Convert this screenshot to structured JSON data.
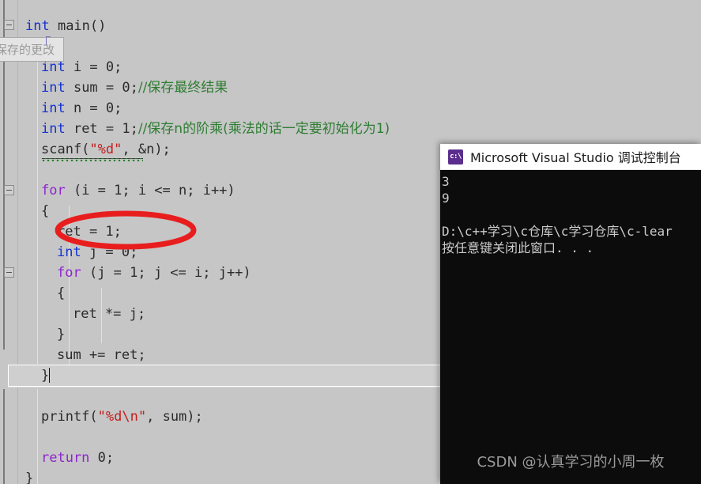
{
  "editor": {
    "background_color": "#c6c6c6",
    "tooltip": {
      "text": "保存的更改"
    },
    "annotation": {
      "shape": "red-ellipse",
      "color": "#e81e1e",
      "target_line": "ret = 1;"
    },
    "lines": [
      {
        "indent": 0,
        "tokens": [
          {
            "t": "int ",
            "c": "kw"
          },
          {
            "t": "main()",
            "c": ""
          }
        ]
      },
      {
        "indent": 0,
        "tokens": []
      },
      {
        "indent": 1,
        "tokens": [
          {
            "t": "int ",
            "c": "kw"
          },
          {
            "t": "i = 0;",
            "c": ""
          }
        ]
      },
      {
        "indent": 1,
        "tokens": [
          {
            "t": "int ",
            "c": "kw"
          },
          {
            "t": "sum = 0;",
            "c": ""
          },
          {
            "t": "//保存最终结果",
            "c": "cmt"
          }
        ]
      },
      {
        "indent": 1,
        "tokens": [
          {
            "t": "int ",
            "c": "kw"
          },
          {
            "t": "n = 0;",
            "c": ""
          }
        ]
      },
      {
        "indent": 1,
        "tokens": [
          {
            "t": "int ",
            "c": "kw"
          },
          {
            "t": "ret = 1;",
            "c": ""
          },
          {
            "t": "//保存n的阶乘(乘法的话一定要初始化为1)",
            "c": "cmt"
          }
        ]
      },
      {
        "indent": 1,
        "tokens": [
          {
            "t": "scanf(",
            "c": ""
          },
          {
            "t": "\"%d\"",
            "c": "str"
          },
          {
            "t": ", &n);",
            "c": ""
          }
        ]
      },
      {
        "indent": 0,
        "tokens": []
      },
      {
        "indent": 1,
        "tokens": [
          {
            "t": "for ",
            "c": "kwf"
          },
          {
            "t": "(i = 1; i <= n; i++)",
            "c": ""
          }
        ]
      },
      {
        "indent": 1,
        "tokens": [
          {
            "t": "{",
            "c": ""
          }
        ]
      },
      {
        "indent": 2,
        "tokens": [
          {
            "t": "ret = 1;",
            "c": ""
          }
        ]
      },
      {
        "indent": 2,
        "tokens": [
          {
            "t": "int ",
            "c": "kw"
          },
          {
            "t": "j = 0;",
            "c": ""
          }
        ]
      },
      {
        "indent": 2,
        "tokens": [
          {
            "t": "for ",
            "c": "kwf"
          },
          {
            "t": "(j = 1; j <= i; j++)",
            "c": ""
          }
        ]
      },
      {
        "indent": 2,
        "tokens": [
          {
            "t": "{",
            "c": ""
          }
        ]
      },
      {
        "indent": 3,
        "tokens": [
          {
            "t": "ret *= j;",
            "c": ""
          }
        ]
      },
      {
        "indent": 2,
        "tokens": [
          {
            "t": "}",
            "c": ""
          }
        ]
      },
      {
        "indent": 2,
        "tokens": [
          {
            "t": "sum += ret;",
            "c": ""
          }
        ]
      },
      {
        "indent": 1,
        "tokens": [
          {
            "t": "}",
            "c": ""
          }
        ],
        "current": true
      },
      {
        "indent": 0,
        "tokens": []
      },
      {
        "indent": 1,
        "tokens": [
          {
            "t": "printf(",
            "c": ""
          },
          {
            "t": "\"%d",
            "c": "str"
          },
          {
            "t": "\\n",
            "c": "esc"
          },
          {
            "t": "\"",
            "c": "str"
          },
          {
            "t": ", sum);",
            "c": ""
          }
        ]
      },
      {
        "indent": 0,
        "tokens": []
      },
      {
        "indent": 1,
        "tokens": [
          {
            "t": "return ",
            "c": "kwf"
          },
          {
            "t": "0;",
            "c": ""
          }
        ]
      },
      {
        "indent": 0,
        "tokens": [
          {
            "t": "}",
            "c": ""
          }
        ]
      }
    ],
    "colors": {
      "keyword_type": "#1432d2",
      "keyword_flow": "#8e24d0",
      "string": "#c21f1f",
      "comment": "#2e7d32",
      "text": "#2b2b2b"
    }
  },
  "console": {
    "title": "Microsoft Visual Studio 调试控制台",
    "icon": "cmd-prompt-icon",
    "icon_label": "c:\\",
    "output": [
      "3",
      "9",
      "",
      "D:\\c++学习\\c仓库\\c学习仓库\\c-lear",
      "按任意键关闭此窗口. . ."
    ],
    "watermark": "CSDN @认真学习的小周一枚",
    "background_color": "#0c0c0c",
    "text_color": "#cccccc"
  }
}
